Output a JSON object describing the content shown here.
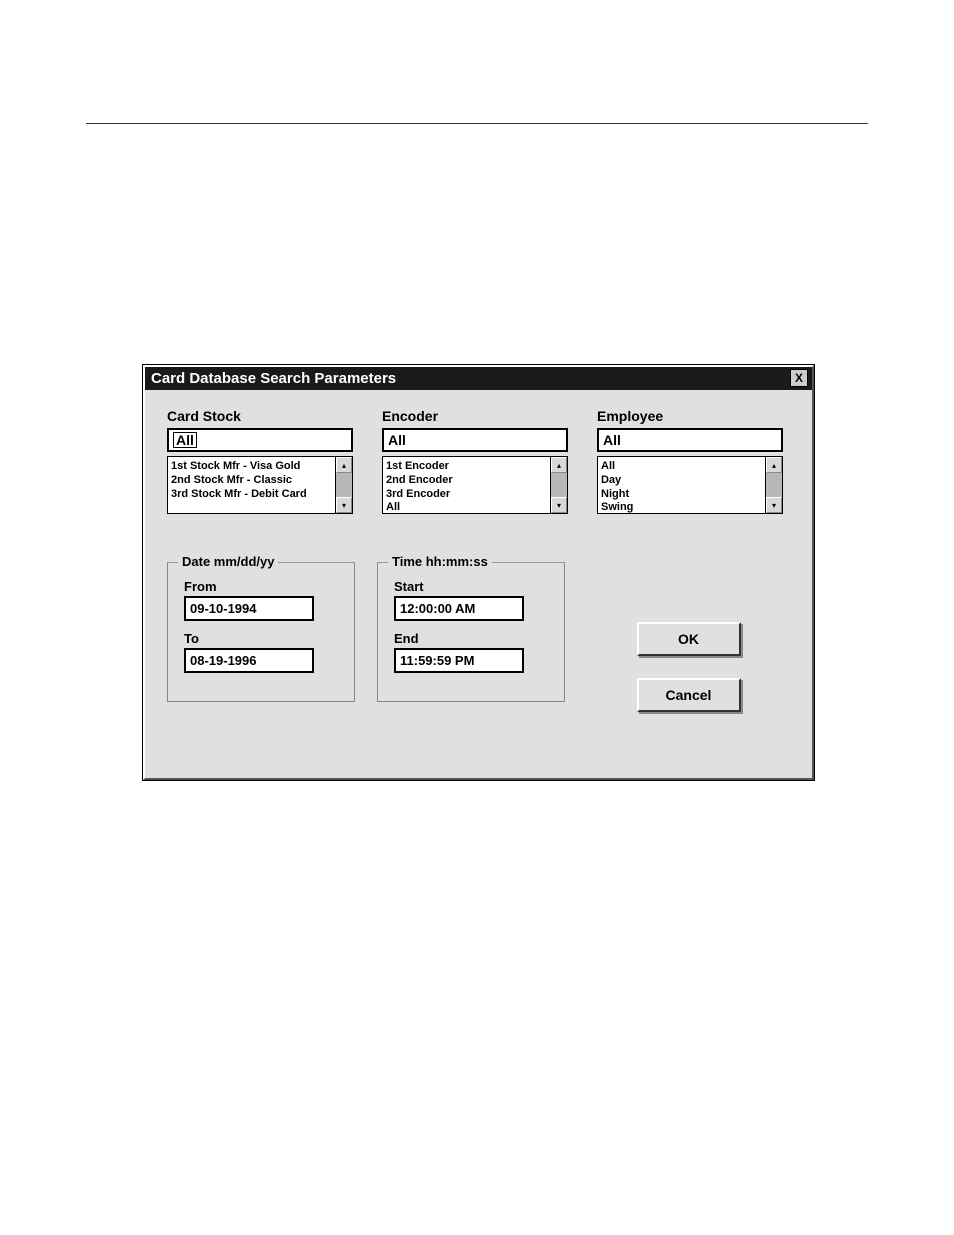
{
  "dialog": {
    "title": "Card Database Search Parameters",
    "close_icon": "X"
  },
  "card_stock": {
    "label": "Card Stock",
    "selected": "All",
    "items": [
      "1st Stock Mfr - Visa Gold",
      "2nd Stock Mfr - Classic",
      "3rd Stock Mfr - Debit Card"
    ]
  },
  "encoder": {
    "label": "Encoder",
    "selected": "All",
    "items": [
      "1st Encoder",
      "2nd Encoder",
      "3rd Encoder",
      "All"
    ]
  },
  "employee": {
    "label": "Employee",
    "selected": "All",
    "items": [
      "All",
      "Day",
      "Night",
      "Swing"
    ]
  },
  "date": {
    "legend": "Date   mm/dd/yy",
    "from_label": "From",
    "from_value": "09-10-1994",
    "to_label": "To",
    "to_value": "08-19-1996"
  },
  "time": {
    "legend": "Time   hh:mm:ss",
    "start_label": "Start",
    "start_value": "12:00:00 AM",
    "end_label": "End",
    "end_value": "11:59:59 PM"
  },
  "buttons": {
    "ok": "OK",
    "cancel": "Cancel"
  }
}
